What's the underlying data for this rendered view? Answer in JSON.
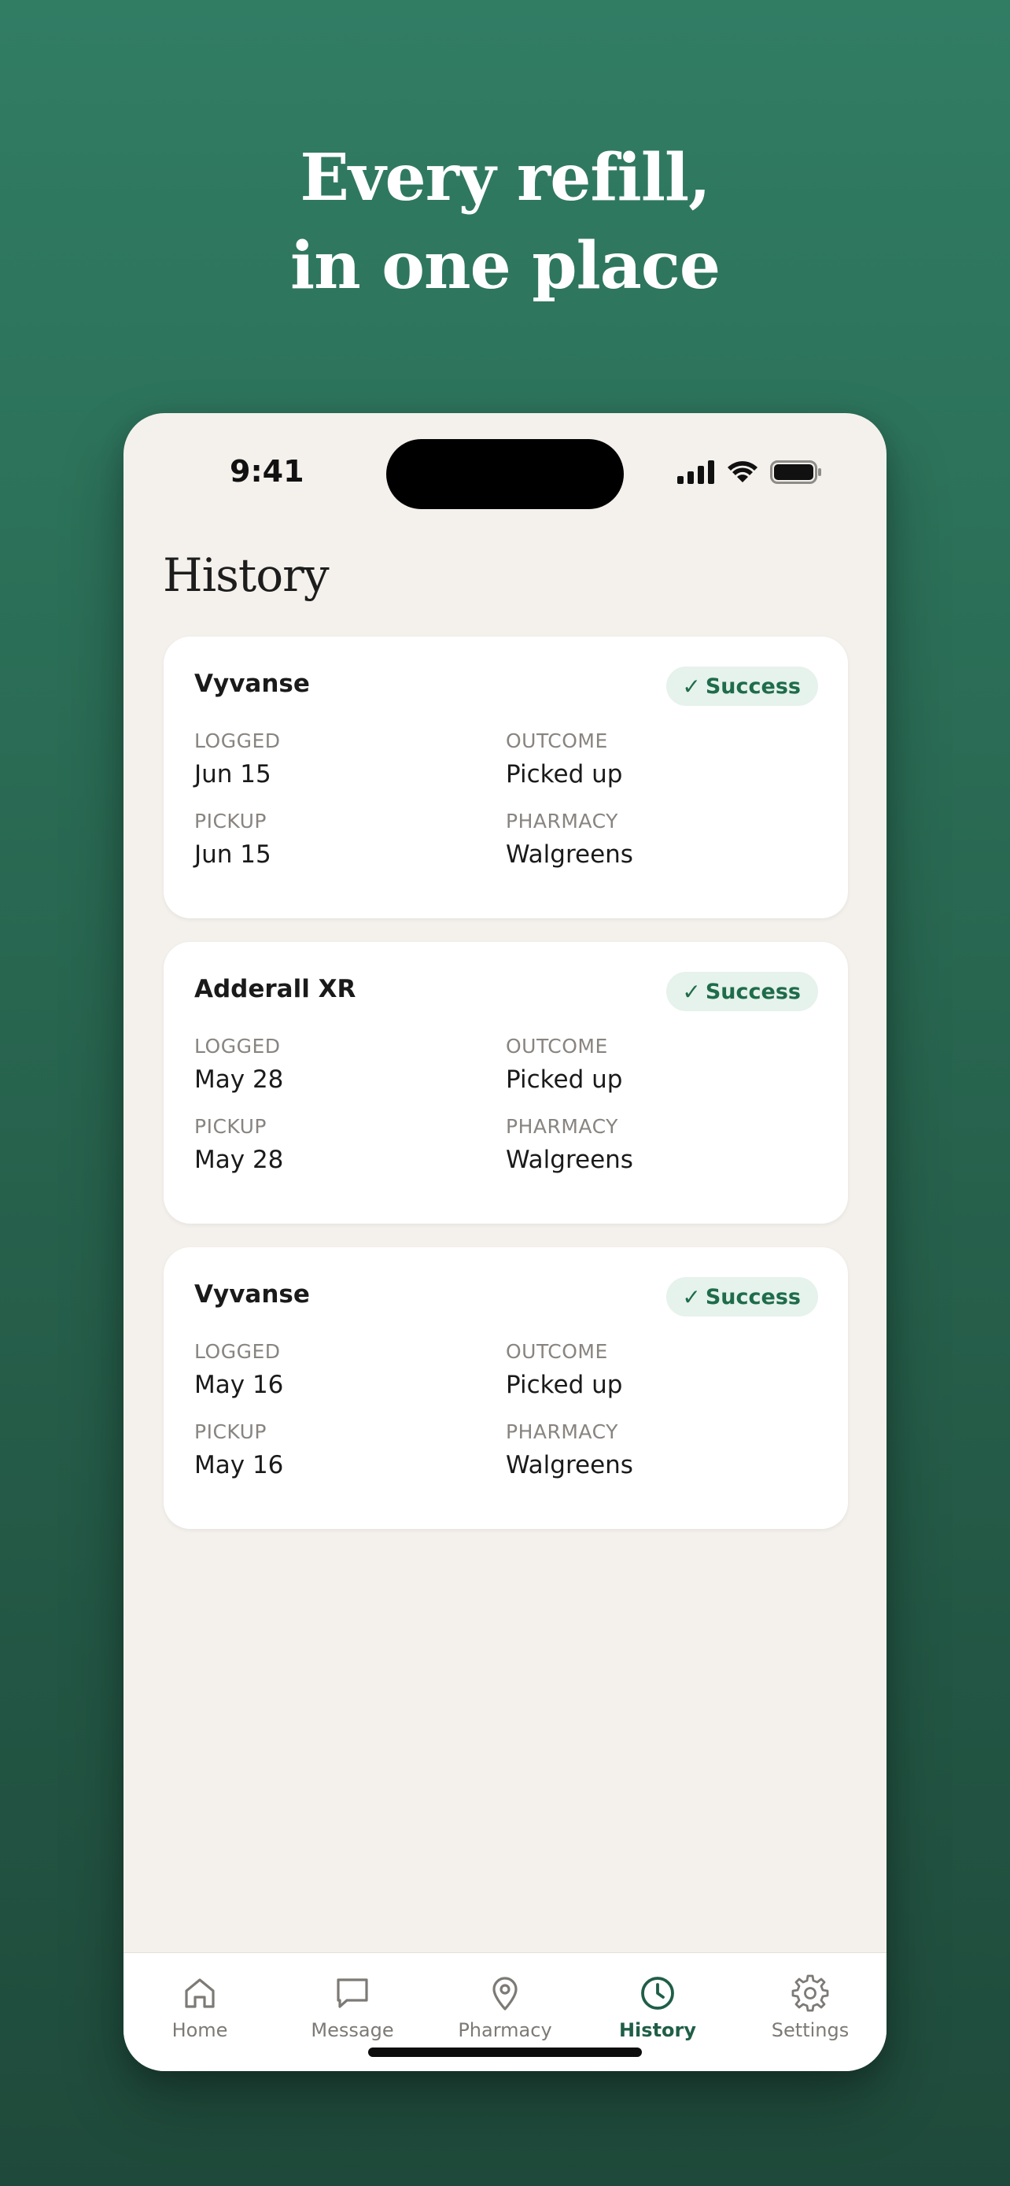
{
  "headline": {
    "line1": "Every refill,",
    "line2": "in one place"
  },
  "status_bar": {
    "time": "9:41",
    "icons": [
      "cellular-signal-icon",
      "wifi-icon",
      "battery-icon"
    ]
  },
  "page": {
    "title": "History"
  },
  "history": [
    {
      "medication": "Vyvanse",
      "status": "Success",
      "logged_label": "LOGGED",
      "logged": "Jun 15",
      "outcome_label": "OUTCOME",
      "outcome": "Picked up",
      "pickup_label": "PICKUP",
      "pickup": "Jun 15",
      "pharmacy_label": "PHARMACY",
      "pharmacy": "Walgreens"
    },
    {
      "medication": "Adderall XR",
      "status": "Success",
      "logged_label": "LOGGED",
      "logged": "May 28",
      "outcome_label": "OUTCOME",
      "outcome": "Picked up",
      "pickup_label": "PICKUP",
      "pickup": "May 28",
      "pharmacy_label": "PHARMACY",
      "pharmacy": "Walgreens"
    },
    {
      "medication": "Vyvanse",
      "status": "Success",
      "logged_label": "LOGGED",
      "logged": "May 16",
      "outcome_label": "OUTCOME",
      "outcome": "Picked up",
      "pickup_label": "PICKUP",
      "pickup": "May 16",
      "pharmacy_label": "PHARMACY",
      "pharmacy": "Walgreens"
    }
  ],
  "tabbar": {
    "active": "History",
    "tabs": [
      {
        "label": "Home",
        "icon": "home-icon"
      },
      {
        "label": "Message",
        "icon": "message-icon"
      },
      {
        "label": "Pharmacy",
        "icon": "map-pin-icon"
      },
      {
        "label": "History",
        "icon": "clock-icon"
      },
      {
        "label": "Settings",
        "icon": "gear-icon"
      }
    ]
  },
  "colors": {
    "background_top": "#317d64",
    "background_bottom": "#1f4a3b",
    "screen": "#f4f1ec",
    "accent": "#1f5e47",
    "badge_bg": "#e6f2ec",
    "badge_text": "#1e6c4a"
  }
}
